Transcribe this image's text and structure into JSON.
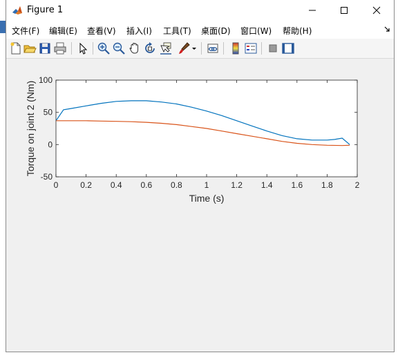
{
  "window": {
    "title": "Figure 1",
    "minimize": "—",
    "maximize": "☐",
    "close": "✕"
  },
  "menu": {
    "items": [
      "文件(F)",
      "编辑(E)",
      "查看(V)",
      "插入(I)",
      "工具(T)",
      "桌面(D)",
      "窗口(W)",
      "帮助(H)"
    ]
  },
  "toolbar": {
    "buttons": [
      "new-figure-icon",
      "open-icon",
      "save-icon",
      "print-icon",
      "pointer-icon",
      "zoom-in-icon",
      "zoom-out-icon",
      "pan-hand-icon",
      "rotate-3d-icon",
      "data-cursor-icon",
      "brush-icon",
      "link-plot-icon",
      "colorbar-icon",
      "legend-icon",
      "hide-plot-tools-icon",
      "show-plot-tools-icon"
    ]
  },
  "colors": {
    "series1": "#0072BD",
    "series2": "#D95319"
  },
  "chart_data": {
    "type": "line",
    "xlabel": "Time (s)",
    "ylabel": "Torque on joint 2 (Nm)",
    "xlim": [
      0,
      2
    ],
    "ylim": [
      -50,
      100
    ],
    "xticks": [
      0,
      0.2,
      0.4,
      0.6,
      0.8,
      1,
      1.2,
      1.4,
      1.6,
      1.8,
      2
    ],
    "xtick_labels": [
      "0",
      "0.2",
      "0.4",
      "0.6",
      "0.8",
      "1",
      "1.2",
      "1.4",
      "1.6",
      "1.8",
      "2"
    ],
    "yticks": [
      -50,
      0,
      50,
      100
    ],
    "ytick_labels": [
      "-50",
      "0",
      "50",
      "100"
    ],
    "grid": false,
    "series": [
      {
        "color": "#0072BD",
        "x": [
          0,
          0.05,
          0.1,
          0.2,
          0.3,
          0.4,
          0.5,
          0.6,
          0.7,
          0.8,
          0.9,
          1.0,
          1.1,
          1.2,
          1.3,
          1.4,
          1.5,
          1.6,
          1.7,
          1.8,
          1.85,
          1.9,
          1.95
        ],
        "y": [
          37,
          54,
          56,
          60,
          64,
          67,
          68,
          68,
          66,
          63,
          58,
          52,
          45,
          37,
          29,
          21,
          14,
          9,
          7,
          7,
          8,
          10,
          0
        ]
      },
      {
        "color": "#D95319",
        "x": [
          0,
          0.1,
          0.2,
          0.3,
          0.4,
          0.5,
          0.6,
          0.7,
          0.8,
          0.9,
          1.0,
          1.1,
          1.2,
          1.3,
          1.4,
          1.5,
          1.6,
          1.7,
          1.8,
          1.9,
          1.95
        ],
        "y": [
          37,
          37,
          37,
          36.5,
          36,
          35.5,
          34.5,
          33,
          31,
          28,
          25,
          21,
          17,
          13,
          9,
          5,
          2,
          0,
          -1,
          -1.5,
          -1
        ]
      }
    ]
  }
}
